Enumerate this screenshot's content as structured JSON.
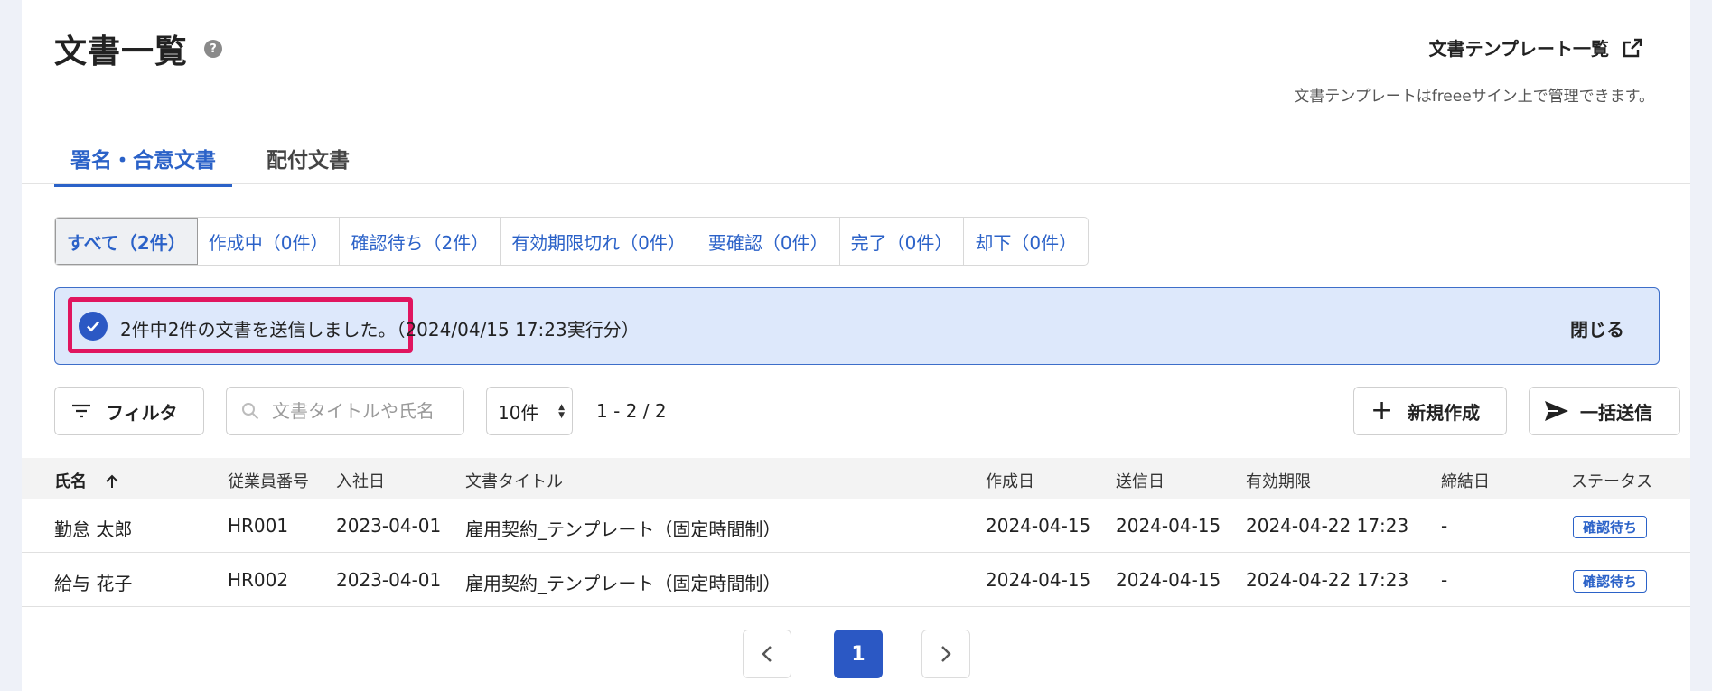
{
  "header": {
    "title": "文書一覧",
    "help_icon": "help-icon",
    "template_link_label": "文書テンプレート一覧",
    "template_link_icon": "external-link-icon",
    "template_note": "文書テンプレートはfreeeサイン上で管理できます。"
  },
  "tabs": [
    {
      "label": "署名・合意文書",
      "active": true
    },
    {
      "label": "配付文書",
      "active": false
    }
  ],
  "status_filters": [
    {
      "label": "すべて（2件）",
      "active": true
    },
    {
      "label": "作成中（0件）",
      "active": false
    },
    {
      "label": "確認待ち（2件）",
      "active": false
    },
    {
      "label": "有効期限切れ（0件）",
      "active": false
    },
    {
      "label": "要確認（0件）",
      "active": false
    },
    {
      "label": "完了（0件）",
      "active": false
    },
    {
      "label": "却下（0件）",
      "active": false
    }
  ],
  "banner": {
    "message": "2件中2件の文書を送信しました。",
    "detail": "（2024/04/15 17:23実行分）",
    "close_label": "閉じる",
    "icon": "check-circle-icon",
    "highlight_color": "#e0155f"
  },
  "toolbar": {
    "filter_label": "フィルタ",
    "search_placeholder": "文書タイトルや氏名",
    "per_page": "10件",
    "range": "1 - 2 / 2",
    "new_label": "新規作成",
    "bulk_send_label": "一括送信"
  },
  "table": {
    "columns": [
      "氏名",
      "従業員番号",
      "入社日",
      "文書タイトル",
      "作成日",
      "送信日",
      "有効期限",
      "締結日",
      "ステータス"
    ],
    "sort_icon": "arrow-up-icon",
    "rows": [
      {
        "name": "勤怠 太郎",
        "employee_no": "HR001",
        "join_date": "2023-04-01",
        "doc_title": "雇用契約_テンプレート（固定時間制）",
        "created": "2024-04-15",
        "sent": "2024-04-15",
        "expires": "2024-04-22 17:23",
        "concluded": "-",
        "status": "確認待ち"
      },
      {
        "name": "給与 花子",
        "employee_no": "HR002",
        "join_date": "2023-04-01",
        "doc_title": "雇用契約_テンプレート（固定時間制）",
        "created": "2024-04-15",
        "sent": "2024-04-15",
        "expires": "2024-04-22 17:23",
        "concluded": "-",
        "status": "確認待ち"
      }
    ]
  },
  "pagination": {
    "prev_icon": "chevron-left-icon",
    "current_page": "1",
    "next_icon": "chevron-right-icon"
  },
  "colors": {
    "accent": "#2b62c8",
    "banner_bg": "#dde8fb"
  }
}
